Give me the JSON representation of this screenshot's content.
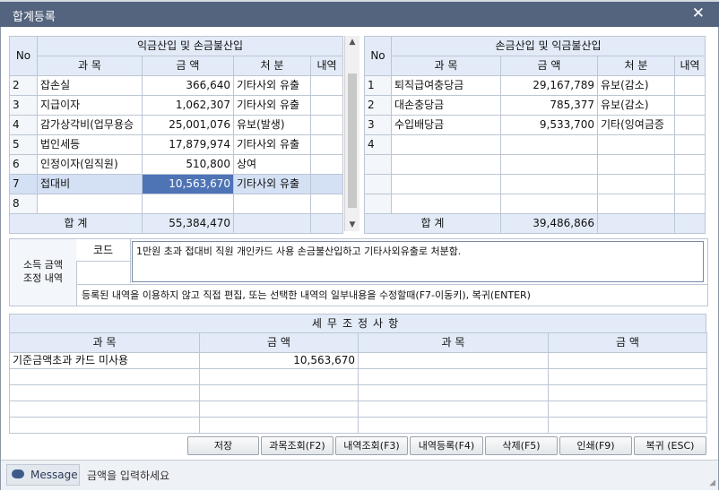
{
  "window": {
    "title": "합계등록",
    "close_glyph": "✕"
  },
  "left_table": {
    "col_no": "No",
    "group_header": "익금산입 및 손금불산입",
    "cols": [
      "과  목",
      "금  액",
      "처  분",
      "내역"
    ],
    "rows": [
      {
        "no": "2",
        "subject": "잡손실",
        "amount": "366,640",
        "disposal": "기타사외 유출",
        "detail": ""
      },
      {
        "no": "3",
        "subject": "지급이자",
        "amount": "1,062,307",
        "disposal": "기타사외 유출",
        "detail": ""
      },
      {
        "no": "4",
        "subject": "감가상각비(업무용승",
        "amount": "25,001,076",
        "disposal": "유보(발생)",
        "detail": ""
      },
      {
        "no": "5",
        "subject": "법인세등",
        "amount": "17,879,974",
        "disposal": "기타사외 유출",
        "detail": ""
      },
      {
        "no": "6",
        "subject": "인정이자(임직원)",
        "amount": "510,800",
        "disposal": "상여",
        "detail": ""
      },
      {
        "no": "7",
        "subject": "접대비",
        "amount": "10,563,670",
        "disposal": "기타사외 유출",
        "detail": ""
      },
      {
        "no": "8",
        "subject": "",
        "amount": "",
        "disposal": "",
        "detail": ""
      }
    ],
    "total_label": "합 계",
    "total_amount": "55,384,470"
  },
  "right_table": {
    "col_no": "No",
    "group_header": "손금산입 및 익금불산입",
    "cols": [
      "과  목",
      "금  액",
      "처  분",
      "내역"
    ],
    "rows": [
      {
        "no": "1",
        "subject": "퇴직급여충당금",
        "amount": "29,167,789",
        "disposal": "유보(감소)",
        "detail": ""
      },
      {
        "no": "2",
        "subject": "대손충당금",
        "amount": "785,377",
        "disposal": "유보(감소)",
        "detail": ""
      },
      {
        "no": "3",
        "subject": "수입배당금",
        "amount": "9,533,700",
        "disposal": "기타(잉여금증",
        "detail": ""
      },
      {
        "no": "4",
        "subject": "",
        "amount": "",
        "disposal": "",
        "detail": ""
      },
      {
        "no": "",
        "subject": "",
        "amount": "",
        "disposal": "",
        "detail": ""
      },
      {
        "no": "",
        "subject": "",
        "amount": "",
        "disposal": "",
        "detail": ""
      },
      {
        "no": "",
        "subject": "",
        "amount": "",
        "disposal": "",
        "detail": ""
      }
    ],
    "total_label": "합 계",
    "total_amount": "39,486,866"
  },
  "adjustment": {
    "label_line1": "소득 금액",
    "label_line2": "조정 내역",
    "code_label": "코드",
    "memo": "1만원 초과 접대비 직원 개인카드 사용 손금불산입하고 기타사외유출로 처분함.",
    "hint": "등록된 내역을 이용하지 않고 직접 편집, 또는 선택한 내역의 일부내용을 수정할때(F7-이동키), 복귀(ENTER)"
  },
  "tax": {
    "title": "세무조정사항",
    "cols": [
      "과    목",
      "금    액",
      "과    목",
      "금    액"
    ],
    "rows": [
      {
        "subject1": "기준금액초과 카드 미사용",
        "amount1": "10,563,670",
        "subject2": "",
        "amount2": ""
      },
      {
        "subject1": "",
        "amount1": "",
        "subject2": "",
        "amount2": ""
      },
      {
        "subject1": "",
        "amount1": "",
        "subject2": "",
        "amount2": ""
      },
      {
        "subject1": "",
        "amount1": "",
        "subject2": "",
        "amount2": ""
      },
      {
        "subject1": "",
        "amount1": "",
        "subject2": "",
        "amount2": ""
      }
    ]
  },
  "buttons": {
    "save": "저장",
    "subject_lookup": "과목조회(F2)",
    "detail_lookup": "내역조회(F3)",
    "detail_register": "내역등록(F4)",
    "delete": "삭제(F5)",
    "print": "인쇄(F9)",
    "back": "복귀 (ESC)"
  },
  "message": {
    "button": "Message",
    "text": "금액을 입력하세요",
    "icon": "speech-bubble-icon"
  },
  "colors": {
    "titlebar": "#54647e",
    "header": "#e2ebf7",
    "selected": "#4e74b6"
  }
}
